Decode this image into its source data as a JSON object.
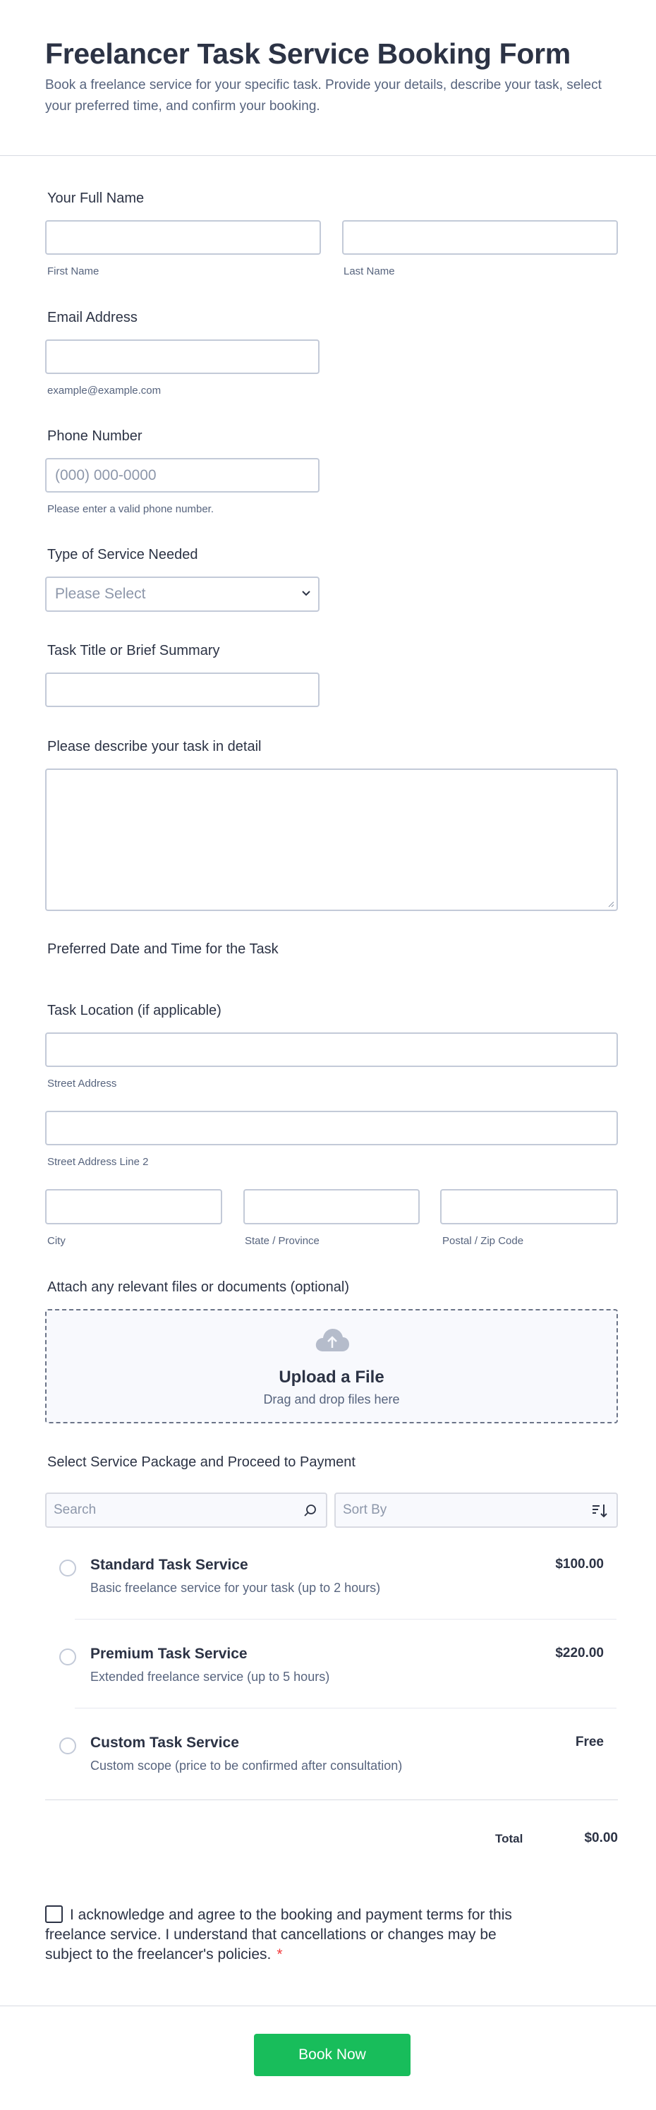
{
  "header": {
    "title": "Freelancer Task Service Booking Form",
    "description": "Book a freelance service for your specific task. Provide your details, describe your task, select your preferred time, and confirm your booking."
  },
  "name": {
    "label": "Your Full Name",
    "first_sublabel": "First Name",
    "last_sublabel": "Last Name"
  },
  "email": {
    "label": "Email Address",
    "sublabel": "example@example.com"
  },
  "phone": {
    "label": "Phone Number",
    "placeholder": "(000) 000-0000",
    "sublabel": "Please enter a valid phone number."
  },
  "service_type": {
    "label": "Type of Service Needed",
    "selected": "Please Select"
  },
  "task_title": {
    "label": "Task Title or Brief Summary"
  },
  "task_description": {
    "label": "Please describe your task in detail"
  },
  "preferred_datetime": {
    "label": "Preferred Date and Time for the Task"
  },
  "location": {
    "label": "Task Location (if applicable)",
    "street_sublabel": "Street Address",
    "street2_sublabel": "Street Address Line 2",
    "city_sublabel": "City",
    "state_sublabel": "State / Province",
    "zip_sublabel": "Postal / Zip Code"
  },
  "upload": {
    "label": "Attach any relevant files or documents (optional)",
    "title": "Upload a File",
    "subtitle": "Drag and drop files here"
  },
  "payment": {
    "label": "Select Service Package and Proceed to Payment",
    "search_placeholder": "Search",
    "sort_placeholder": "Sort By",
    "products": [
      {
        "name": "Standard Task Service",
        "description": "Basic freelance service for your task (up to 2 hours)",
        "price": "$100.00"
      },
      {
        "name": "Premium Task Service",
        "description": "Extended freelance service (up to 5 hours)",
        "price": "$220.00"
      },
      {
        "name": "Custom Task Service",
        "description": "Custom scope (price to be confirmed after consultation)",
        "price": "Free"
      }
    ],
    "total_label": "Total",
    "total_value": "$0.00"
  },
  "terms": {
    "text": "I acknowledge and agree to the booking and payment terms for this freelance service. I understand that cancellations or changes may be subject to the freelancer's policies.",
    "required_mark": "*"
  },
  "submit": {
    "label": "Book Now"
  },
  "colors": {
    "primary_text": "#2c3345",
    "secondary_text": "#57647e",
    "submit_green": "#18bd5b",
    "required_red": "#f23a3c"
  }
}
